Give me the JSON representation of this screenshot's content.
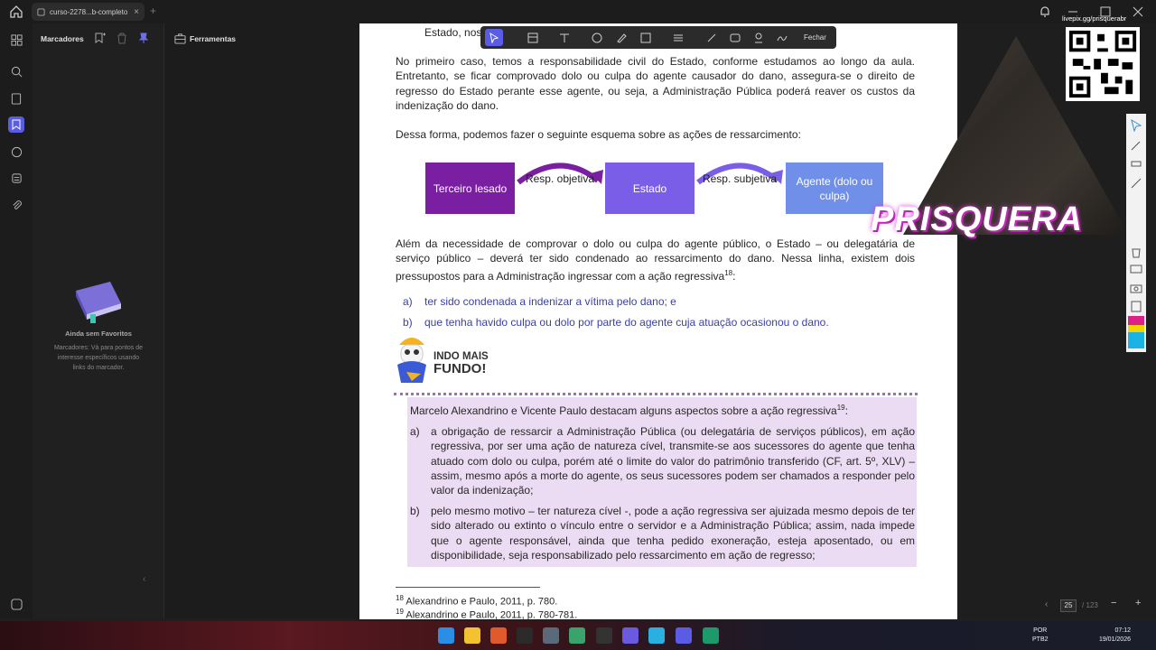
{
  "tab": {
    "title": "curso-2278...b-completo",
    "close": "×",
    "new": "+"
  },
  "bookmarks": {
    "title": "Marcadores",
    "empty_title": "Ainda sem Favoritos",
    "empty_hint": "Marcadores: Vá para pontos de interesse específicos usando links do marcador.",
    "nav_more": "···"
  },
  "tools": {
    "title": "Ferramentas"
  },
  "annot_toolbar": {
    "close_label": "Fechar"
  },
  "document": {
    "top_fragment": "Estado, nos",
    "p1": "No primeiro caso, temos a responsabilidade civil do Estado, conforme estudamos ao longo da aula. Entretanto, se ficar comprovado dolo ou culpa do agente causador do dano, assegura-se o direito de regresso do Estado perante esse agente, ou seja, a Administração Pública poderá reaver os custos da indenização do dano.",
    "p2": "Dessa forma, podemos fazer o seguinte esquema sobre as ações de ressarcimento:",
    "diagram": {
      "box1": "Terceiro lesado",
      "arrow1": "Resp. objetiva",
      "box2": "Estado",
      "arrow2": "Resp. subjetiva",
      "box3": "Agente (dolo ou culpa)",
      "colors": {
        "box1": "#7b1fa2",
        "box2": "#7b5ee8",
        "box3": "#6f8fe8",
        "arrow": "#7b1fa2"
      }
    },
    "p3": "Além da necessidade de comprovar o dolo ou culpa do agente público, o Estado – ou delegatária de serviço público – deverá ter sido condenado ao ressarcimento do dano. Nessa linha, existem dois pressupostos para a Administração ingressar com a ação regressiva",
    "p3_sup": "18",
    "p3_end": ":",
    "list1": [
      {
        "letter": "a)",
        "text": "ter sido condenada a indenizar a vítima pelo dano; e"
      },
      {
        "letter": "b)",
        "text": "que tenha havido culpa ou dolo por parte do agente cuja atuação ocasionou o dano."
      }
    ],
    "fundo": {
      "line1": "INDO MAIS",
      "line2": "FUNDO!"
    },
    "box_intro": "Marcelo Alexandrino e Vicente Paulo destacam alguns aspectos sobre a ação regressiva",
    "box_intro_sup": "19",
    "box_intro_end": ":",
    "box_items": [
      {
        "letter": "a)",
        "text": "a obrigação de ressarcir a Administração Pública (ou delegatária de serviços públicos), em ação regressiva, por ser uma ação de natureza cível, transmite-se aos sucessores do agente que tenha atuado com dolo ou culpa, porém até o limite do valor do patrimônio transferido (CF, art. 5º, XLV) – assim, mesmo após a morte do agente, os seus sucessores podem ser chamados a responder pelo valor da indenização;"
      },
      {
        "letter": "b)",
        "text": "pelo mesmo motivo – ter natureza cível -, pode a ação regressiva ser ajuizada mesmo depois de ter sido alterado ou extinto o vínculo entre o servidor e a Administração Pública; assim, nada impede que o agente responsável, ainda que tenha pedido exoneração, esteja aposentado, ou em disponibilidade, seja responsabilizado pelo ressarcimento em ação de regresso;"
      }
    ],
    "footnotes": [
      {
        "num": "18",
        "text": "Alexandrino e Paulo, 2011, p. 780."
      },
      {
        "num": "19",
        "text": "Alexandrino e Paulo, 2011, p. 780-781."
      }
    ]
  },
  "overlay": {
    "brand": "PRISQUERA",
    "qr_caption": "livepix.gg/prisquerabr"
  },
  "page_nav": {
    "current": "25",
    "total": "/ 123",
    "zoom_out": "−",
    "zoom_in": "+"
  },
  "taskbar": {
    "lang": "POR",
    "lang2": "PTB2",
    "time": "07:12",
    "date": "19/01/2026"
  }
}
